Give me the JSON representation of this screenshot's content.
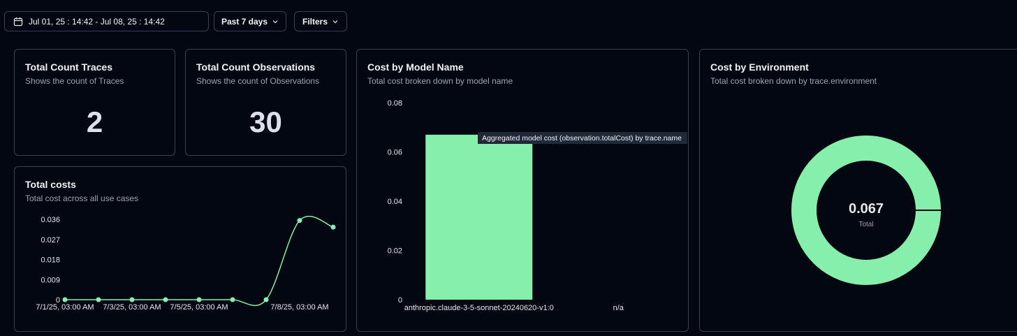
{
  "toolbar": {
    "date_range": "Jul 01, 25 : 14:42 - Jul 08, 25 : 14:42",
    "preset": "Past 7 days",
    "filters": "Filters"
  },
  "cards": {
    "traces": {
      "title": "Total Count Traces",
      "subtitle": "Shows the count of Traces",
      "value": "2"
    },
    "observations": {
      "title": "Total Count Observations",
      "subtitle": "Shows the count of Observations",
      "value": "30"
    },
    "total_costs": {
      "title": "Total costs",
      "subtitle": "Total cost across all use cases"
    },
    "cost_model": {
      "title": "Cost by Model Name",
      "subtitle": "Total cost broken down by model name",
      "tooltip": "Aggregated model cost (observation.totalCost) by trace.name"
    },
    "cost_env": {
      "title": "Cost by Environment",
      "subtitle": "Total cost broken down by trace.environment",
      "center_value": "0.067",
      "center_label": "Total"
    }
  },
  "colors": {
    "accent": "#86efac",
    "background": "#030712",
    "border": "#374151"
  },
  "chart_data": [
    {
      "type": "line",
      "title": "Total costs",
      "x": [
        "7/1/25, 03:00 AM",
        "7/2/25, 03:00 AM",
        "7/3/25, 03:00 AM",
        "7/4/25, 03:00 AM",
        "7/5/25, 03:00 AM",
        "7/6/25, 03:00 AM",
        "7/7/25, 03:00 AM",
        "7/8/25, 03:00 AM",
        "7/9/25, 03:00 AM"
      ],
      "x_tick_labels": [
        "7/1/25, 03:00 AM",
        "7/3/25, 03:00 AM",
        "7/5/25, 03:00 AM",
        "7/8/25, 03:00 AM"
      ],
      "y": [
        0,
        0,
        0,
        0,
        0,
        0,
        0,
        0.0355,
        0.0325
      ],
      "yticks": [
        0,
        0.009,
        0.018,
        0.027,
        0.036
      ],
      "ylim": [
        0,
        0.036
      ]
    },
    {
      "type": "bar",
      "title": "Cost by Model Name",
      "categories": [
        "anthropic.claude-3-5-sonnet-20240620-v1:0",
        "n/a"
      ],
      "values": [
        0.067,
        0
      ],
      "yticks": [
        0,
        0.02,
        0.04,
        0.06,
        0.08
      ],
      "ylim": [
        0,
        0.08
      ]
    },
    {
      "type": "pie",
      "title": "Cost by Environment",
      "slices": [
        {
          "value": 0.067
        }
      ],
      "total": 0.067
    }
  ]
}
